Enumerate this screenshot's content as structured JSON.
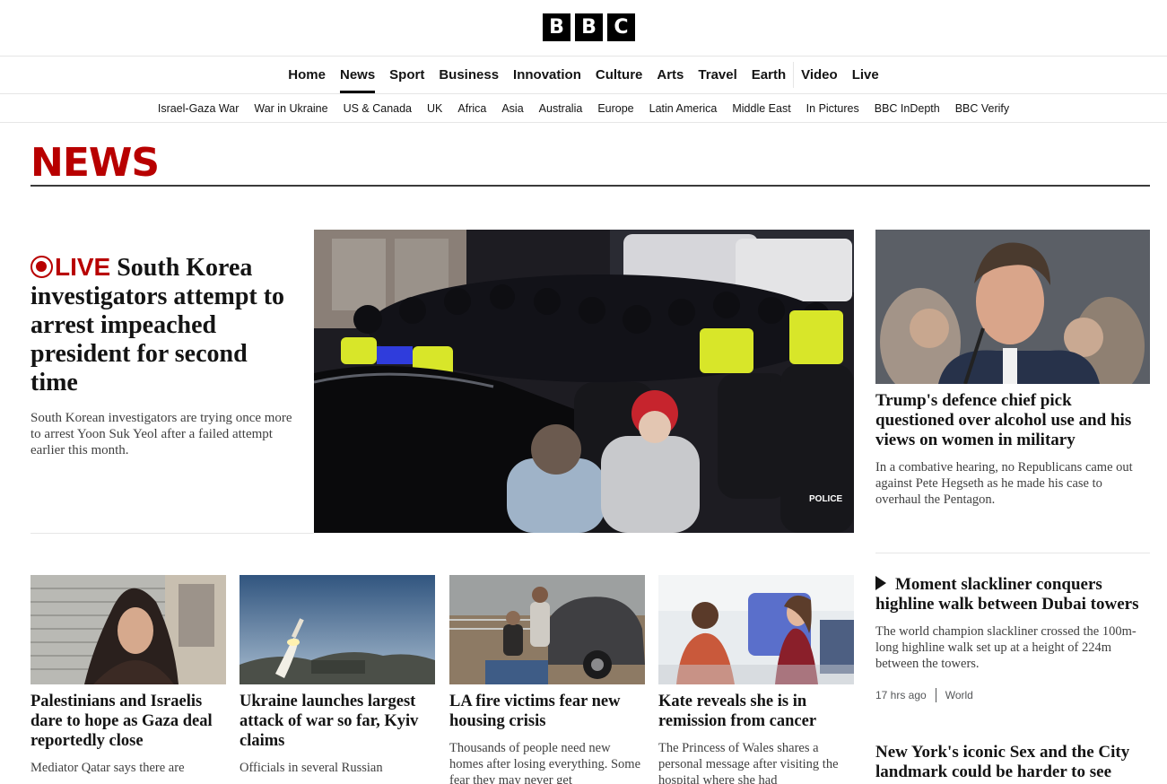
{
  "brand": {
    "letters": [
      "B",
      "B",
      "C"
    ]
  },
  "nav": {
    "items": [
      "Home",
      "News",
      "Sport",
      "Business",
      "Innovation",
      "Culture",
      "Arts",
      "Travel",
      "Earth",
      "Video",
      "Live"
    ],
    "active": "News"
  },
  "subnav": {
    "items": [
      "Israel-Gaza War",
      "War in Ukraine",
      "US & Canada",
      "UK",
      "Africa",
      "Asia",
      "Australia",
      "Europe",
      "Latin America",
      "Middle East",
      "In Pictures",
      "BBC InDepth",
      "BBC Verify"
    ]
  },
  "section": {
    "title": "NEWS"
  },
  "lead": {
    "live_label": "LIVE",
    "headline": "South Korea investigators attempt to arrest impeached president for second time",
    "summary": "South Korean investigators are trying once more to arrest Yoon Suk Yeol after a failed attempt earlier this month."
  },
  "side": [
    {
      "headline": "Trump's defence chief pick questioned over alcohol use and his views on women in military",
      "summary": "In a combative hearing, no Republicans came out against Pete Hegseth as he made his case to overhaul the Pentagon."
    },
    {
      "headline": "Moment slackliner conquers highline walk between Dubai towers",
      "summary": "The world champion slackliner crossed the 100m-long highline walk set up at a height of 224m between the towers.",
      "time": "17 hrs ago",
      "tag": "World",
      "icon": "play-icon"
    },
    {
      "headline": "New York's iconic Sex and the City landmark could be harder to see"
    }
  ],
  "cards": [
    {
      "headline": "Palestinians and Israelis dare to hope as Gaza deal reportedly close",
      "summary": "Mediator Qatar says there are"
    },
    {
      "headline": "Ukraine launches largest attack of war so far, Kyiv claims",
      "summary": "Officials in several Russian"
    },
    {
      "headline": "LA fire victims fear new housing crisis",
      "summary": "Thousands of people need new homes after losing everything. Some fear they may never get"
    },
    {
      "headline": "Kate reveals she is in remission from cancer",
      "summary": "The Princess of Wales shares a personal message after visiting the hospital where she had"
    }
  ],
  "colors": {
    "accent": "#b80000",
    "text": "#141414",
    "muted": "#3f3f3f"
  }
}
